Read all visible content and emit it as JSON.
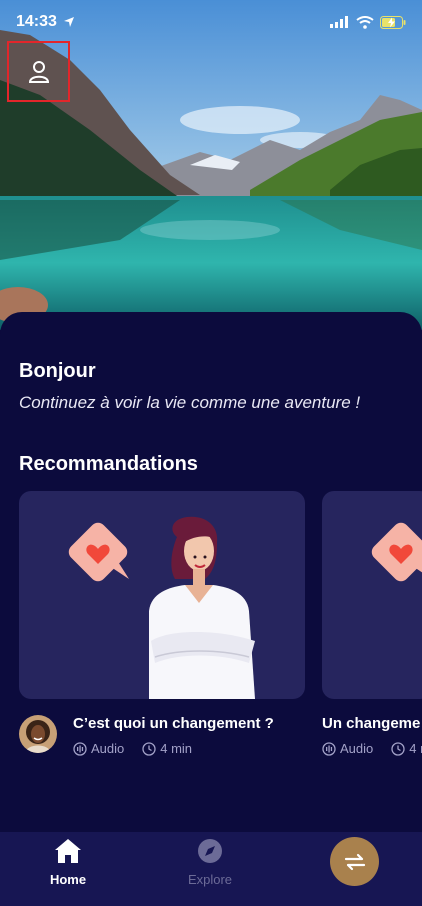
{
  "status_bar": {
    "time": "14:33"
  },
  "greeting": {
    "title": "Bonjour",
    "subtitle": "Continuez à voir la vie comme une aventure !"
  },
  "recommendations": {
    "title": "Recommandations",
    "items": [
      {
        "title": "C’est quoi un changement ?",
        "type": "Audio",
        "duration": "4 min"
      },
      {
        "title": "Un changeme",
        "type": "Audio",
        "duration": "4 m"
      }
    ]
  },
  "tabbar": {
    "home_label": "Home",
    "explore_label": "Explore"
  },
  "colors": {
    "background": "#0c0b3d",
    "card": "#26255e",
    "tabbar": "#171653",
    "accent": "#a9814d",
    "highlight": "#e3262b"
  }
}
